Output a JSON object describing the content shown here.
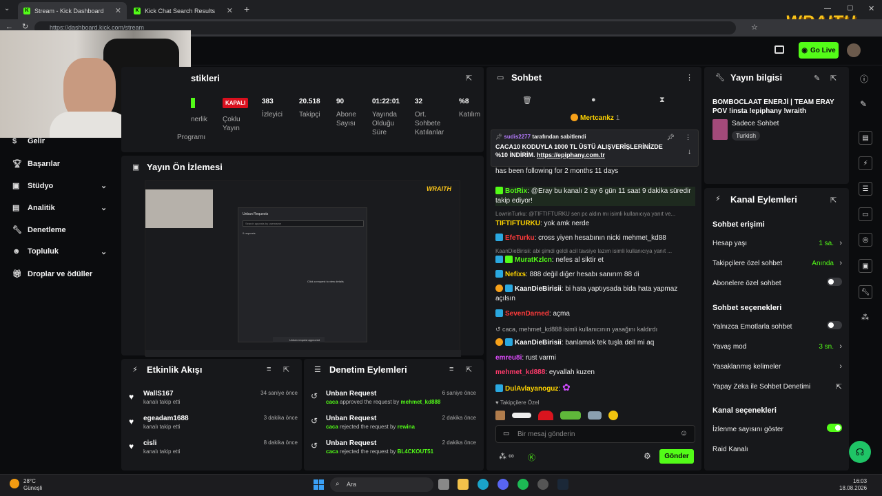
{
  "browser": {
    "tabs": [
      {
        "title": "Stream - Kick Dashboard"
      },
      {
        "title": "Kick Chat Search Results"
      }
    ],
    "url": "https://dashboard.kick.com/stream",
    "logo_text": "WRAITH"
  },
  "header": {
    "go_live": "Go Live"
  },
  "sidebar": {
    "items": [
      {
        "label": "Gelir",
        "chevron": false
      },
      {
        "label": "Başarılar",
        "chevron": false
      },
      {
        "label": "Stüdyo",
        "chevron": true
      },
      {
        "label": "Analitik",
        "chevron": true
      },
      {
        "label": "Denetleme",
        "chevron": false
      },
      {
        "label": "Topluluk",
        "chevron": true
      },
      {
        "label": "Droplar ve ödüller",
        "chevron": false
      }
    ]
  },
  "stats": {
    "title_partial": "stikleri",
    "partial_left": [
      "nerlik",
      "Programı"
    ],
    "kapali": "KAPALI",
    "cols": [
      {
        "label": "Çoklu Yayın",
        "value": ""
      },
      {
        "label": "İzleyici",
        "value": "383"
      },
      {
        "label": "Takipçi",
        "value": "20.518"
      },
      {
        "label": "Abone Sayısı",
        "value": "90"
      },
      {
        "label": "Yayında Olduğu Süre",
        "value": "01:22:01"
      },
      {
        "label": "Ort. Sohbete Katılanlar",
        "value": "32"
      },
      {
        "label": "Katılım",
        "value": "%8"
      }
    ]
  },
  "preview": {
    "title": "Yayın Ön İzlemesi",
    "modal_title": "Unban Requests",
    "modal_search": "Search appeals by username",
    "modal_count": "0 requests",
    "modal_hint": "Click a request to view details",
    "toast": "Unban request approved",
    "logo": "WRAITH"
  },
  "events": {
    "title": "Etkinlik Akışı",
    "items": [
      {
        "name": "WallS167",
        "sub": "kanalı takip etti",
        "time": "34 saniye önce"
      },
      {
        "name": "egeadam1688",
        "sub": "kanalı takip etti",
        "time": "3 dakika önce"
      },
      {
        "name": "cisli",
        "sub": "kanalı takip etti",
        "time": "8 dakika önce"
      }
    ]
  },
  "moderation": {
    "title": "Denetim Eylemleri",
    "items": [
      {
        "name": "Unban Request",
        "actor": "caca",
        "verb": " approved the request by ",
        "target": "mehmet_kd888",
        "time": "6 saniye önce"
      },
      {
        "name": "Unban Request",
        "actor": "caca",
        "verb": " rejected the request by ",
        "target": "rewina",
        "time": "2 dakika önce"
      },
      {
        "name": "Unban Request",
        "actor": "caca",
        "verb": " rejected the request by ",
        "target": "BL4CKOUT51",
        "time": "2 dakika önce"
      }
    ]
  },
  "chat": {
    "title": "Sohbet",
    "top_user": "Mertcankz",
    "top_count": "1",
    "pinned": {
      "user": "sudis2277",
      "by": "tarafından sabitlendi",
      "text": "CACA10 KODUYLA 1000 TL ÜSTÜ ALIŞVERİŞLERİNİZDE %10 İNDİRİM.",
      "link": "https://epiphany.com.tr"
    },
    "under_pinned": "has been following for 2 months 11 days",
    "messages": [
      {
        "user": "BotRix",
        "color": "#53fc18",
        "text": ": @Eray bu kanalı 2 ay 6 gün 11 saat 9 dakika süredir takip ediyor!"
      },
      {
        "reply": "LowrinTurku: @TIFTIFTURKU sen pc aldın mı isimli kullanıcıya yanıt ve..."
      },
      {
        "user": "TIFTIFTURKU",
        "color": "#ffd400",
        "text": ": yok amk nerde"
      },
      {
        "user": "EfeTurku",
        "color": "#ff3b3b",
        "text": ": cross yiyen hesabının nicki mehmet_kd88"
      },
      {
        "reply": "KaanDieBirisii: abi şimdi geldi acil tavsiye lazım isimli kullanıcıya yanıt ..."
      },
      {
        "user": "MuratKzlcn",
        "color": "#53fc18",
        "text": ": nefes al siktir et"
      },
      {
        "user": "Nefixs",
        "color": "#ffd400",
        "text": ": 888 değil diğer hesabı sanırım 88 di"
      },
      {
        "user": "KaanDieBirisii",
        "color": "#ffffff",
        "text": ": bi hata yaptıysada bida hata yapmaz açılsın"
      },
      {
        "user": "SevenDarned",
        "color": "#ff3b3b",
        "text": ": açma"
      },
      {
        "notice": "caca, mehmet_kd888 isimli kullanıcının yasağını kaldırdı"
      },
      {
        "user": "KaanDieBirisii",
        "color": "#ffffff",
        "text": ": banlamak tek tuşla deil mi aq"
      },
      {
        "user": "emreu8i",
        "color": "#e04bff",
        "text": ": rust varmi"
      },
      {
        "user": "mehmet_kd888",
        "color": "#ff3b6b",
        "text": ": eyvallah kuzen"
      },
      {
        "user": "DulAvlayanoguz",
        "color": "#ffd400",
        "text": ":"
      }
    ],
    "followers_only": "Takipçilere Özel",
    "input_placeholder": "Bir mesaj gönderin",
    "send": "Gönder"
  },
  "stream_info": {
    "title": "Yayın bilgisi",
    "stream_title": "BOMBOCLAAT ENERJİ | TEAM ERAY POV !insta !epiphany !wraith",
    "category": "Sadece Sohbet",
    "tag": "Turkish"
  },
  "channel_actions": {
    "title": "Kanal Eylemleri",
    "sections": [
      {
        "title": "Sohbet erişimi",
        "rows": [
          {
            "label": "Hesap yaşı",
            "value": "1 sa.",
            "type": "chevron"
          },
          {
            "label": "Takipçilere özel sohbet",
            "value": "Anında",
            "type": "chevron"
          },
          {
            "label": "Abonelere özel sohbet",
            "value": "",
            "type": "toggle-off"
          }
        ]
      },
      {
        "title": "Sohbet seçenekleri",
        "rows": [
          {
            "label": "Yalnızca Emotlarla sohbet",
            "value": "",
            "type": "toggle-off"
          },
          {
            "label": "Yavaş mod",
            "value": "3 sn.",
            "type": "chevron"
          },
          {
            "label": "Yasaklanmış kelimeler",
            "value": "",
            "type": "chevron"
          },
          {
            "label": "Yapay Zeka ile Sohbet Denetimi",
            "value": "",
            "type": "external"
          }
        ]
      },
      {
        "title": "Kanal seçenekleri",
        "rows": [
          {
            "label": "İzlenme sayısını göster",
            "value": "",
            "type": "toggle-on"
          },
          {
            "label": "Raid Kanalı",
            "value": "",
            "type": "none"
          }
        ]
      }
    ]
  },
  "taskbar": {
    "weather_temp": "28°C",
    "weather_desc": "Güneşli",
    "search": "Ara",
    "time": "16:03",
    "date": "18.08.2026"
  },
  "colors": {
    "accent": "#53fc18",
    "panel": "#17181b",
    "bg": "#0b0c0e"
  }
}
